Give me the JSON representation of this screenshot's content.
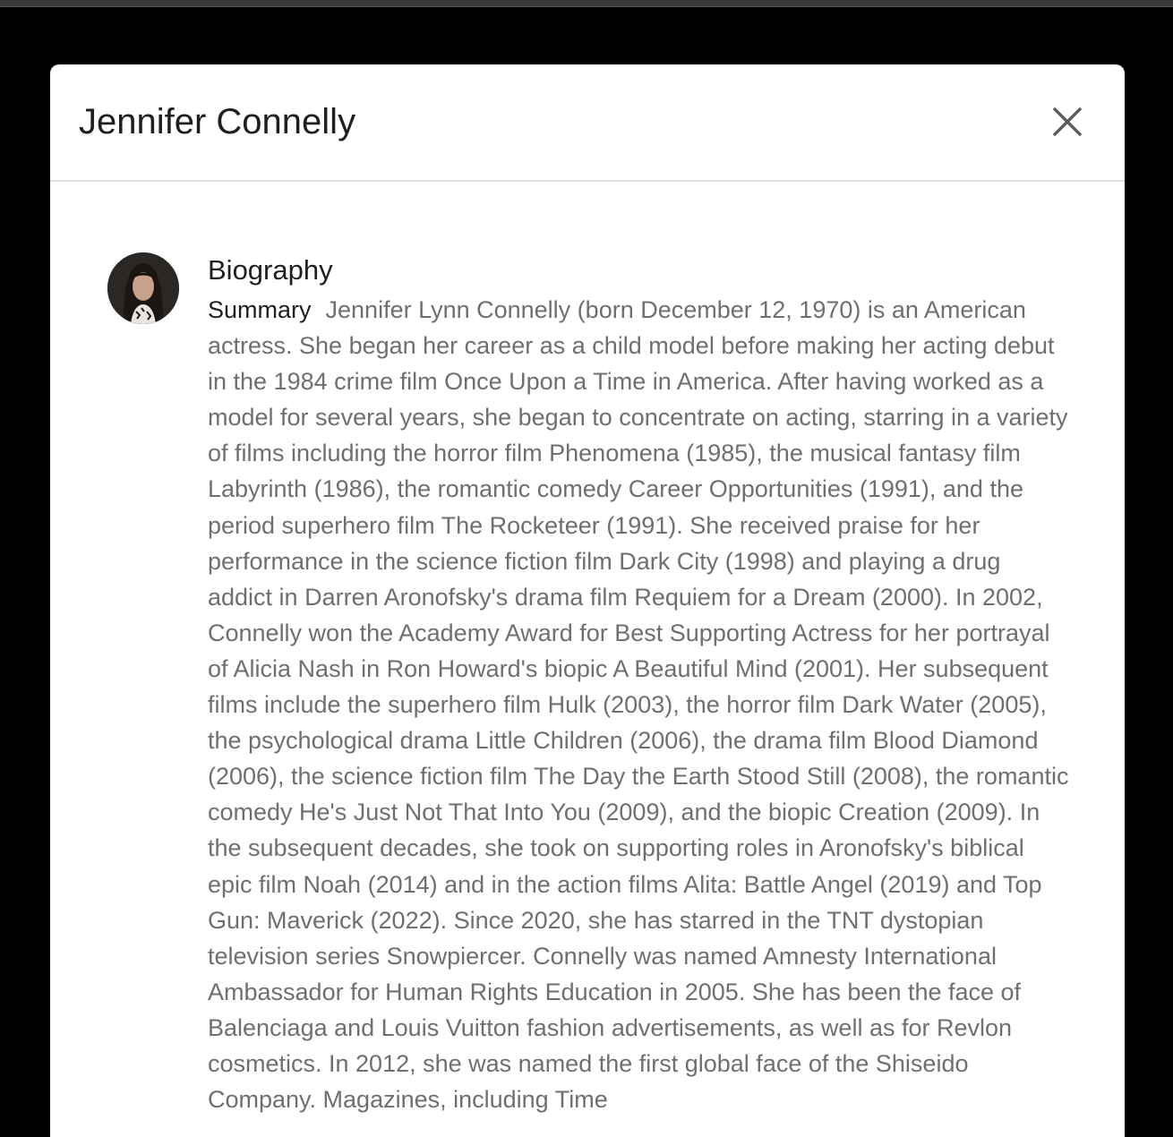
{
  "modal": {
    "title": "Jennifer Connelly",
    "close_icon": "close-icon"
  },
  "avatar": {
    "icon": "person-portrait"
  },
  "biography": {
    "heading": "Biography",
    "summary_label": "Summary",
    "summary_text": "Jennifer Lynn Connelly (born December 12, 1970) is an American actress. She began her career as a child model before making her acting debut in the 1984 crime film Once Upon a Time in America. After having worked as a model for several years, she began to concentrate on acting, starring in a variety of films including the horror film Phenomena (1985), the musical fantasy film Labyrinth (1986), the romantic comedy Career Opportunities (1991), and the period superhero film The Rocketeer (1991). She received praise for her performance in the science fiction film Dark City (1998) and playing a drug addict in Darren Aronofsky's drama film Requiem for a Dream (2000). In 2002, Connelly won the Academy Award for Best Supporting Actress for her portrayal of Alicia Nash in Ron Howard's biopic A Beautiful Mind (2001). Her subsequent films include the superhero film Hulk (2003), the horror film Dark Water (2005), the psychological drama Little Children (2006), the drama film Blood Diamond (2006), the science fiction film The Day the Earth Stood Still (2008), the romantic comedy He's Just Not That Into You (2009), and the biopic Creation (2009). In the subsequent decades, she took on supporting roles in Aronofsky's biblical epic film Noah (2014) and in the action films Alita: Battle Angel (2019) and Top Gun: Maverick (2022). Since 2020, she has starred in the TNT dystopian television series Snowpiercer. Connelly was named Amnesty International Ambassador for Human Rights Education in 2005. She has been the face of Balenciaga and Louis Vuitton fashion advertisements, as well as for Revlon cosmetics. In 2012, she was named the first global face of the Shiseido Company. Magazines, including Time"
  },
  "colors": {
    "backdrop": "#000000",
    "modal_bg": "#ffffff",
    "title_text": "#1f1f1f",
    "body_text": "#6f6f6f",
    "divider": "#e2e2e2"
  }
}
